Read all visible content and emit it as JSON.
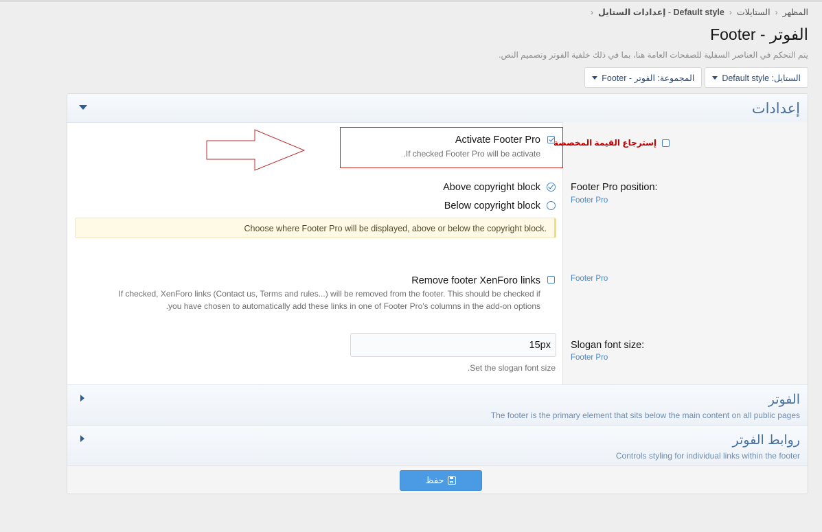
{
  "breadcrumb": [
    "المظهر",
    "الستايلات",
    "Default style",
    "إعدادات الستايل"
  ],
  "page": {
    "title": "الفوتر - Footer",
    "description": "يتم التحكم في العناصر السفلية للصفحات العامة هنا، بما في ذلك خلفية الفوتر وتصميم النص."
  },
  "toolbar": {
    "style_selector": "الستايل: Default style",
    "group_selector": "المجموعة: الفوتر - Footer"
  },
  "section_settings": {
    "title": "إعدادات"
  },
  "option_activate": {
    "revert_label": "إسترجاع القيمة المخصصة",
    "label": "Activate Footer Pro",
    "hint": "If checked Footer Pro will be activate.",
    "checked": true
  },
  "option_position": {
    "label": "Footer Pro position:",
    "group": "Footer Pro",
    "choice_above": "Above copyright block",
    "choice_below": "Below copyright block",
    "selected": "Above copyright block",
    "notice": "Choose where Footer Pro will be displayed, above or below the copyright block."
  },
  "option_remove_links": {
    "group": "Footer Pro",
    "label": "Remove footer XenForo links",
    "hint_line1": "If checked, XenForo links (Contact us, Terms and rules...) will be removed from the footer. This should be checked if",
    "hint_line2": "you have chosen to automatically add these links in one of Footer Pro's columns in the add-on options.",
    "checked": false
  },
  "option_slogan": {
    "label": "Slogan font size:",
    "group": "Footer Pro",
    "value": "15px",
    "hint": "Set the slogan font size."
  },
  "section_footer": {
    "title": "الفوتر",
    "desc": "The footer is the primary element that sits below the main content on all public pages"
  },
  "section_footer_links": {
    "title": "روابط الفوتر",
    "desc": "Controls styling for individual links within the footer"
  },
  "actions": {
    "save_label": "حفظ"
  },
  "colors": {
    "accent": "#47709e",
    "button": "#4a9be3",
    "highlight_border": "#cc2222"
  }
}
